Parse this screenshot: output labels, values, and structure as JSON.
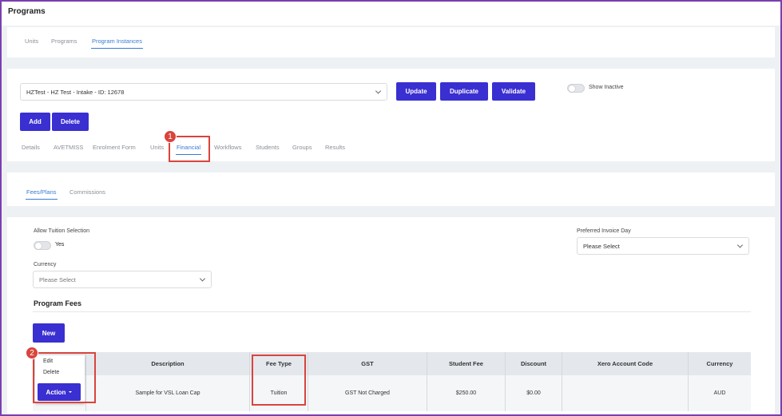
{
  "app": {
    "title": "Programs"
  },
  "top_tabs": [
    {
      "label": "Units",
      "active": false
    },
    {
      "label": "Programs",
      "active": false
    },
    {
      "label": "Program Instances",
      "active": true
    }
  ],
  "instance_selector": {
    "value": "HZTest - HZ Test - Intake - ID: 12678"
  },
  "header_buttons": {
    "update": "Update",
    "duplicate": "Duplicate",
    "validate": "Validate"
  },
  "show_inactive": {
    "label": "Show Inactive",
    "on": false
  },
  "record_buttons": {
    "add": "Add",
    "delete": "Delete"
  },
  "instance_tabs": [
    {
      "label": "Details",
      "active": false
    },
    {
      "label": "AVETMISS",
      "active": false
    },
    {
      "label": "Enrolment Form",
      "active": false
    },
    {
      "label": "Units",
      "active": false
    },
    {
      "label": "Financial",
      "active": true
    },
    {
      "label": "Workflows",
      "active": false
    },
    {
      "label": "Students",
      "active": false
    },
    {
      "label": "Groups",
      "active": false
    },
    {
      "label": "Results",
      "active": false
    }
  ],
  "financial_tabs": [
    {
      "label": "Fees/Plans",
      "active": true
    },
    {
      "label": "Commissions",
      "active": false
    }
  ],
  "form": {
    "allow_tuition_label": "Allow Tuition Selection",
    "allow_tuition_value": "Yes",
    "preferred_invoice_label": "Preferred Invoice Day",
    "preferred_invoice_placeholder": "Please Select",
    "currency_label": "Currency",
    "currency_placeholder": "Please Select"
  },
  "program_fees": {
    "heading": "Program Fees",
    "new_button": "New",
    "columns": [
      "Description",
      "Fee Type",
      "GST",
      "Student Fee",
      "Discount",
      "Xero Account Code",
      "Currency"
    ],
    "rows": [
      {
        "description": "Sample for VSL Loan Cap",
        "fee_type": "Tuition",
        "gst": "GST Not Charged",
        "student_fee": "$250.00",
        "discount": "$0.00",
        "xero_account_code": "",
        "currency": "AUD"
      }
    ]
  },
  "action_menu": {
    "button": "Action",
    "items": [
      "Edit",
      "Delete"
    ]
  },
  "annotations": {
    "step1": "1",
    "step2": "2"
  },
  "colors": {
    "primary": "#3a2fd0",
    "accent": "#3a7bd5",
    "callout": "#d9443c",
    "frame": "#7a3fb0"
  }
}
